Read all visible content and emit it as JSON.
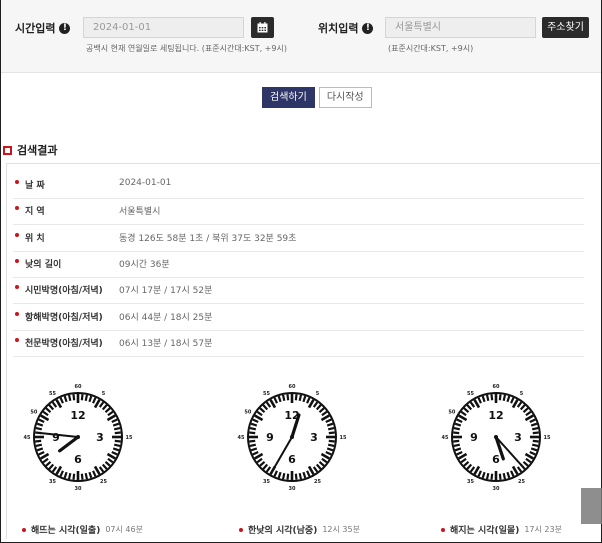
{
  "search": {
    "time_label": "시간입력",
    "date_value": "2024-01-01",
    "time_help": "공백시 현재 연월일로 세팅됩니다. (표준시간대:KST, +9시)",
    "location_label": "위치입력",
    "location_value": "서울특별시",
    "address_button": "주소찾기",
    "location_help": "(표준시간대:KST, +9시)"
  },
  "actions": {
    "search_button": "검색하기",
    "reset_button": "다시작성"
  },
  "results": {
    "title": "검색결과",
    "rows": [
      {
        "key": "날 짜",
        "value": "2024-01-01"
      },
      {
        "key": "지 역",
        "value": "서울특별시"
      },
      {
        "key": "위 치",
        "value": "동경 126도 58분 1초 / 북위 37도 32분 59초"
      },
      {
        "key": "낮의 길이",
        "value": "09시간 36분"
      },
      {
        "key": "시민박명(아침/저녁)",
        "value": "07시 17분 / 17시 52분"
      },
      {
        "key": "항해박명(아침/저녁)",
        "value": "06시 44분 / 18시 25분"
      },
      {
        "key": "천문박명(아침/저녁)",
        "value": "06시 13분 / 18시 57분"
      }
    ],
    "clocks": [
      {
        "caption": "해뜨는 시각(일출)",
        "time": "07시 46분",
        "hour": 7,
        "minute": 46
      },
      {
        "caption": "한낮의 시각(남중)",
        "time": "12시 35분",
        "hour": 12,
        "minute": 35
      },
      {
        "caption": "해지는 시각(일몰)",
        "time": "17시 23분",
        "hour": 17,
        "minute": 23
      }
    ],
    "dial_numbers": [
      "12",
      "3",
      "6",
      "9"
    ],
    "minute_numbers": [
      "60",
      "5",
      "15",
      "25",
      "30",
      "35",
      "45",
      "50",
      "55"
    ]
  },
  "colors": {
    "accent_red": "#c9161c",
    "primary_button": "#2e3567",
    "dark_button": "#2b2b2b"
  }
}
